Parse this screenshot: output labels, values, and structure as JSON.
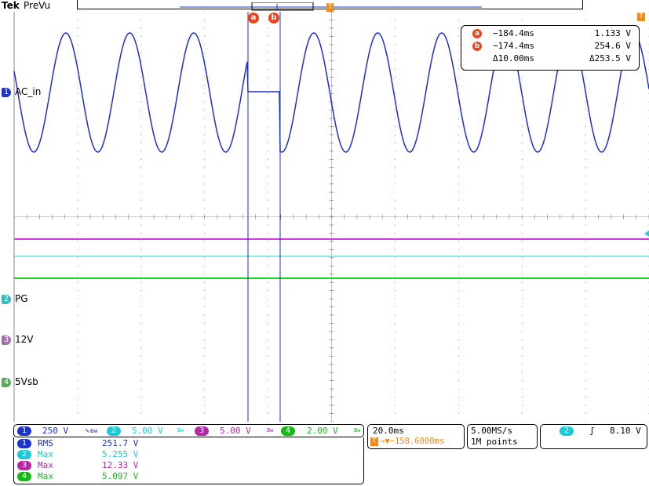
{
  "header": {
    "brand": "Tek",
    "mode": "PreVu"
  },
  "colors": {
    "ch1": "#1e33c8",
    "ch2": "#1ec8d8",
    "ch3": "#b428a8",
    "ch4": "#18b818",
    "ch1_trace": "#1e2fcf",
    "ch2_trace": "#2cc9d3",
    "ch3_trace": "#d33ad8",
    "ch4_trace": "#22cc22",
    "cursor": "#e8441c",
    "trigger": "#f08a1c"
  },
  "channels": [
    {
      "num": "1",
      "label": "AC_in"
    },
    {
      "num": "2",
      "label": "PG"
    },
    {
      "num": "3",
      "label": "12V"
    },
    {
      "num": "4",
      "label": "5Vsb"
    }
  ],
  "cursors": {
    "a_tag": "a",
    "b_tag": "b",
    "a_time": "−184.4ms",
    "a_value": "1.133 V",
    "b_time": "−174.4ms",
    "b_value": "254.6 V",
    "delta_time": "Δ10.00ms",
    "delta_value": "Δ253.5 V"
  },
  "trigger_marker": "T",
  "scales": {
    "ch1": "250 V",
    "ch2": "5.00 V",
    "ch3": "5.00 V",
    "ch4": "2.00 V",
    "ch1_coupling": "∿ʙw",
    "bw": "Bw"
  },
  "timebase": {
    "time_div": "20.0ms",
    "trigger_pos": "→▼−158.6000ms"
  },
  "acquisition": {
    "sample_rate": "5.00MS/s",
    "record_length": "1M points"
  },
  "trigger": {
    "source": "2",
    "slope": "ʃ",
    "level": "8.10 V"
  },
  "measurements": [
    {
      "ch": "1",
      "name": "RMS",
      "value": "251.7 V"
    },
    {
      "ch": "2",
      "name": "Max",
      "value": "5.255 V"
    },
    {
      "ch": "3",
      "name": "Max",
      "value": "12.33 V"
    },
    {
      "ch": "4",
      "name": "Max",
      "value": "5.097 V"
    }
  ]
}
